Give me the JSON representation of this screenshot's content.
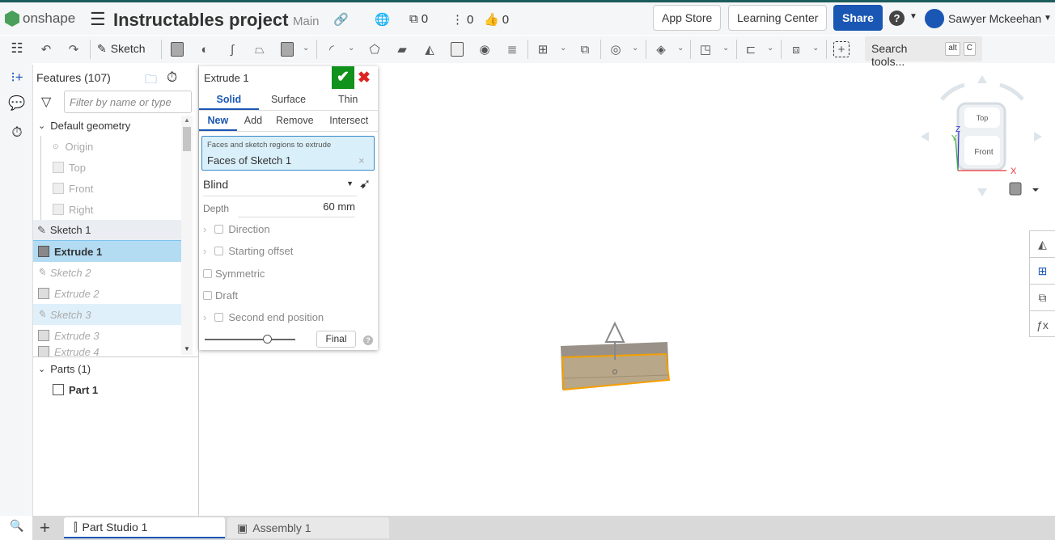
{
  "header": {
    "brand": "onshape",
    "title": "Instructables project",
    "branch": "Main",
    "versions_count": "0",
    "branches_count": "0",
    "likes_count": "0",
    "app_store": "App Store",
    "learning_center": "Learning Center",
    "share": "Share",
    "user": "Sawyer Mckeehan"
  },
  "toolbar": {
    "sketch": "Sketch",
    "search": "Search tools...",
    "kbd1": "alt",
    "kbd2": "C"
  },
  "features": {
    "title": "Features (107)",
    "filter_placeholder": "Filter by name or type",
    "default_geometry": "Default geometry",
    "items": [
      {
        "label": "Origin"
      },
      {
        "label": "Top"
      },
      {
        "label": "Front"
      },
      {
        "label": "Right"
      },
      {
        "label": "Sketch 1"
      },
      {
        "label": "Extrude 1"
      },
      {
        "label": "Sketch 2"
      },
      {
        "label": "Extrude 2"
      },
      {
        "label": "Sketch 3"
      },
      {
        "label": "Extrude 3"
      },
      {
        "label": "Extrude 4"
      }
    ],
    "parts_header": "Parts (1)",
    "parts": [
      {
        "label": "Part 1"
      }
    ]
  },
  "dialog": {
    "title": "Extrude 1",
    "type_tabs": [
      "Solid",
      "Surface",
      "Thin"
    ],
    "op_tabs": [
      "New",
      "Add",
      "Remove",
      "Intersect"
    ],
    "query_label": "Faces and sketch regions to extrude",
    "query_value": "Faces of Sketch 1",
    "end_type": "Blind",
    "depth_label": "Depth",
    "depth_value": "60 mm",
    "direction": "Direction",
    "starting_offset": "Starting offset",
    "symmetric": "Symmetric",
    "draft": "Draft",
    "second_end": "Second end position",
    "final": "Final",
    "slider_value": 0.7
  },
  "viewcube": {
    "top": "Top",
    "front": "Front",
    "x": "X",
    "y": "Y",
    "z": "Z"
  },
  "tabs": [
    {
      "label": "Part Studio 1",
      "active": true
    },
    {
      "label": "Assembly 1",
      "active": false
    }
  ],
  "colors": {
    "accent": "#1a56b3",
    "ok": "#11921d",
    "selection": "#f5a000"
  }
}
